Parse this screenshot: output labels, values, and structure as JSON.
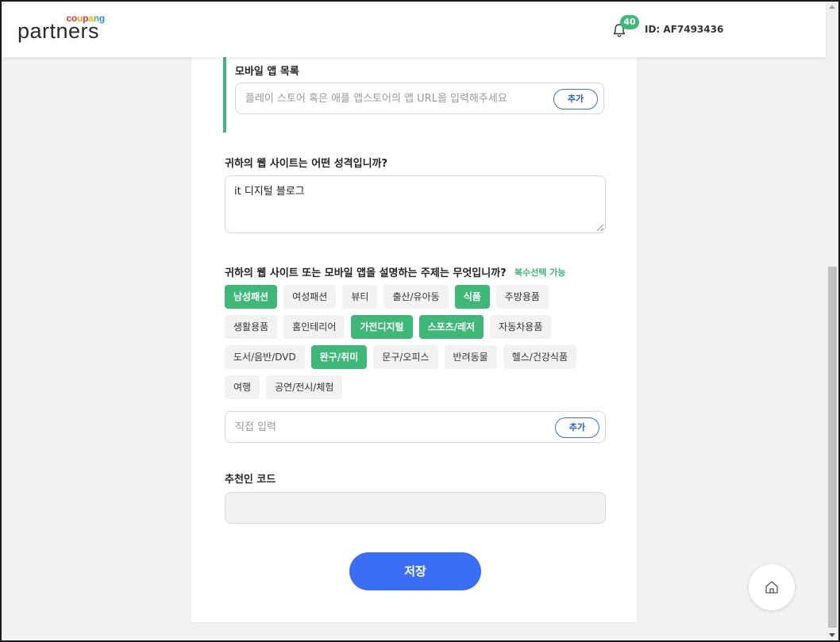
{
  "brand": {
    "coupang_letters": [
      {
        "char": "c",
        "color": "#e8342b"
      },
      {
        "char": "o",
        "color": "#e8342b"
      },
      {
        "char": "u",
        "color": "#f39a1e"
      },
      {
        "char": "p",
        "color": "#e8342b"
      },
      {
        "char": "a",
        "color": "#f4b400"
      },
      {
        "char": "n",
        "color": "#3db876"
      },
      {
        "char": "g",
        "color": "#2b8cd6"
      }
    ],
    "partners": "partners"
  },
  "header": {
    "notification_count": "40",
    "user_id": "ID: AF7493436"
  },
  "app_list": {
    "label": "모바일 앱 목록",
    "placeholder": "플레이 스토어 혹은 애플 앱스토어의 앱 URL을 입력해주세요",
    "value": "",
    "add_label": "추가"
  },
  "site_nature": {
    "label": "귀하의 웹 사이트는 어떤 성격입니까?",
    "value": "it 디지털 블로그"
  },
  "topics": {
    "label": "귀하의 웹 사이트 또는 모바일 앱을 설명하는 주제는 무엇입니까?",
    "multi_select_note": "복수선택 가능",
    "rows": [
      [
        {
          "label": "남성패션",
          "selected": true
        },
        {
          "label": "여성패션",
          "selected": false
        },
        {
          "label": "뷰티",
          "selected": false
        },
        {
          "label": "출산/유아동",
          "selected": false
        },
        {
          "label": "식품",
          "selected": true
        },
        {
          "label": "주방용품",
          "selected": false
        }
      ],
      [
        {
          "label": "생활용품",
          "selected": false
        },
        {
          "label": "홈인테리어",
          "selected": false
        },
        {
          "label": "가전디지털",
          "selected": true
        },
        {
          "label": "스포츠/레저",
          "selected": true
        },
        {
          "label": "자동차용품",
          "selected": false
        }
      ],
      [
        {
          "label": "도서/음반/DVD",
          "selected": false
        },
        {
          "label": "완구/취미",
          "selected": true
        },
        {
          "label": "문구/오피스",
          "selected": false
        },
        {
          "label": "반려동물",
          "selected": false
        },
        {
          "label": "헬스/건강식품",
          "selected": false
        }
      ],
      [
        {
          "label": "여행",
          "selected": false
        },
        {
          "label": "공연/전시/체험",
          "selected": false
        }
      ]
    ],
    "custom_placeholder": "직접 입력",
    "custom_value": "",
    "add_label": "추가"
  },
  "referral": {
    "label": "추천인 코드",
    "value": ""
  },
  "save_label": "저장",
  "colors": {
    "accent_green": "#3db876",
    "primary_blue": "#3a6ff5"
  }
}
